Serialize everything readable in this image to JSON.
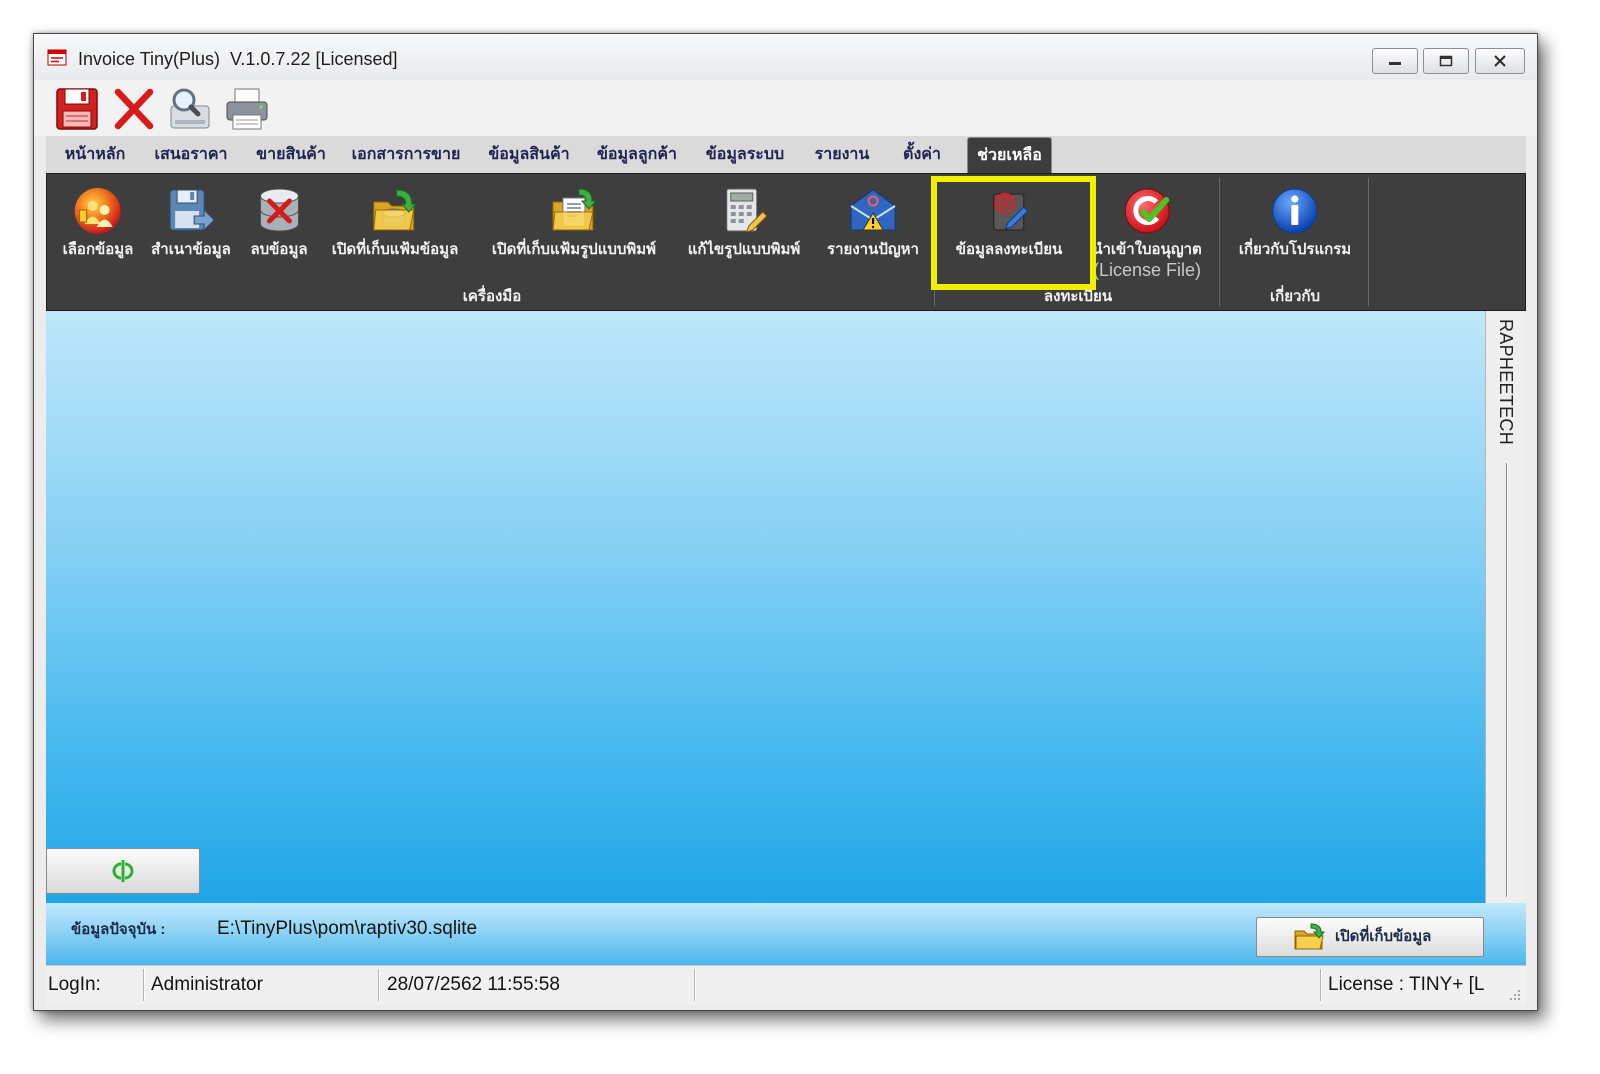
{
  "window": {
    "title": "Invoice Tiny(Plus)  V.1.0.7.22 [Licensed]",
    "app_icon": "tiny-app-icon",
    "controls": {
      "minimize": "minimize-icon",
      "maximize": "maximize-icon",
      "close": "close-icon"
    }
  },
  "toolbar": {
    "items": [
      {
        "icon": "save-icon"
      },
      {
        "icon": "delete-icon"
      },
      {
        "icon": "preview-icon"
      },
      {
        "icon": "printer-icon"
      }
    ]
  },
  "menu": {
    "tabs": [
      "หน้าหลัก",
      "เสนอราคา",
      "ขายสินค้า",
      "เอกสารการขาย",
      "ข้อมูลสินค้า",
      "ข้อมูลลูกค้า",
      "ข้อมูลระบบ",
      "รายงาน",
      "ตั้งค่า",
      "ช่วยเหลือ"
    ],
    "selected_index": 9
  },
  "ribbon": {
    "groups": [
      {
        "label": "เครื่องมือ",
        "items": [
          {
            "label": "เลือกข้อมูล",
            "icon": "select-data-icon"
          },
          {
            "label": "สำเนาข้อมูล",
            "icon": "copy-data-icon"
          },
          {
            "label": "ลบข้อมูล",
            "icon": "delete-data-icon"
          },
          {
            "label": "เปิดที่เก็บแฟ้มข้อมูล",
            "icon": "open-data-folder-icon"
          },
          {
            "label": "เปิดที่เก็บแฟ้มรูปแบบพิมพ์",
            "icon": "open-template-folder-icon"
          },
          {
            "label": "แก้ไขรูปแบบพิมพ์",
            "icon": "edit-template-icon"
          },
          {
            "label": "รายงานปัญหา",
            "icon": "report-problem-icon"
          }
        ]
      },
      {
        "label": "ลงทะเบียน",
        "items": [
          {
            "label": "ข้อมูลลงทะเบียน",
            "icon": "registration-icon"
          },
          {
            "label": "นำเข้าใบอนุญาต",
            "sublabel": "(License File)",
            "icon": "import-license-icon"
          }
        ]
      },
      {
        "label": "เกี่ยวกับ",
        "items": [
          {
            "label": "เกี่ยวกับโปรแกรม",
            "icon": "info-icon"
          }
        ]
      }
    ]
  },
  "side_panel": {
    "label": "RAPHEETECH"
  },
  "workspace": {
    "toggle_icon": "toggle-panel-icon"
  },
  "footer": {
    "current_data_label": "ข้อมูลปัจจุบัน :",
    "current_data_path": "E:\\TinyPlus\\pom\\raptiv30.sqlite",
    "open_folder_button": "เปิดที่เก็บข้อมูล",
    "open_folder_icon": "open-folder-icon"
  },
  "status_bar": {
    "login_label": "LogIn:",
    "user": "Administrator",
    "datetime": "28/07/2562 11:55:58",
    "license": "License : TINY+ [L"
  },
  "colors": {
    "ribbon_bg": "#3e3e3e",
    "selected_tab_bg": "#3d3d3d",
    "workspace_top": "#bde7f9",
    "workspace_bottom": "#1fa5e7",
    "highlight": "#f2ee00"
  }
}
